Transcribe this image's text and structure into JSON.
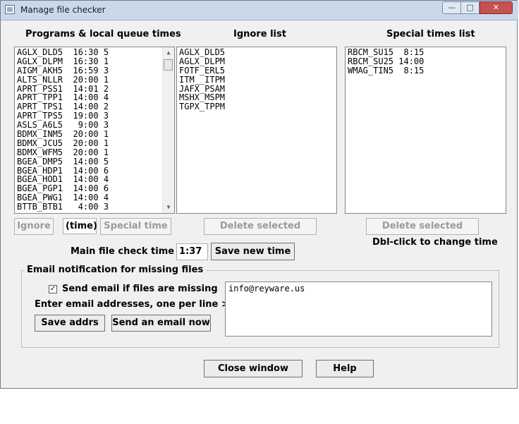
{
  "window": {
    "title": "Manage file checker",
    "min_glyph": "—",
    "max_glyph": "□",
    "close_glyph": "✕"
  },
  "programs": {
    "heading": "Programs & local queue times",
    "items": [
      "AGLX_DLD5  16:30 5",
      "AGLX_DLPM  16:30 1",
      "AIGM_AKH5  16:59 3",
      "ALTS_NLLR  20:00 1",
      "APRT_PSS1  14:01 2",
      "APRT_TPP1  14:00 4",
      "APRT_TPS1  14:00 2",
      "APRT_TPS5  19:00 3",
      "ASLS_A6L5   9:00 3",
      "BDMX_INM5  20:00 1",
      "BDMX_JCU5  20:00 1",
      "BDMX_WFM5  20:00 1",
      "BGEA_DMP5  14:00 5",
      "BGEA_HDP1  14:00 6",
      "BGEA_HOD1  14:00 4",
      "BGEA_PGP1  14:00 6",
      "BGEA_PWG1  14:00 4",
      "BTTB_BTB1   4:00 3"
    ],
    "ignore_button": "Ignore",
    "time_input": "(time)",
    "special_time_button": "Special time",
    "scroll_up": "▲",
    "scroll_down": "▼"
  },
  "ignore_list": {
    "heading": "Ignore list",
    "items": [
      "AGLX_DLD5",
      "AGLX_DLPM",
      "FOTF_ERL5",
      "ITM__ITPM",
      "JAFX_PSAM",
      "MSHX_MSPM",
      "TGPX_TPPM"
    ],
    "delete_button": "Delete selected"
  },
  "special_list": {
    "heading": "Special times list",
    "items": [
      "RBCM_SU15  8:15",
      "RBCM_SU25 14:00",
      "WMAG_TIN5  8:15"
    ],
    "delete_button": "Delete selected",
    "hint": "Dbl-click to change time"
  },
  "main_check": {
    "label": "Main file check time is",
    "value": "1:37",
    "save_button": "Save new time"
  },
  "email": {
    "group_title": "Email notification for missing files",
    "checkbox_label": "Send email if files are missing",
    "checkbox_checked": true,
    "instructions": "Enter email addresses, one per line >>>",
    "save_button": "Save addrs",
    "send_button": "Send an email now",
    "addresses": "info@reyware.us"
  },
  "footer": {
    "close_button": "Close window",
    "help_button": "Help"
  }
}
